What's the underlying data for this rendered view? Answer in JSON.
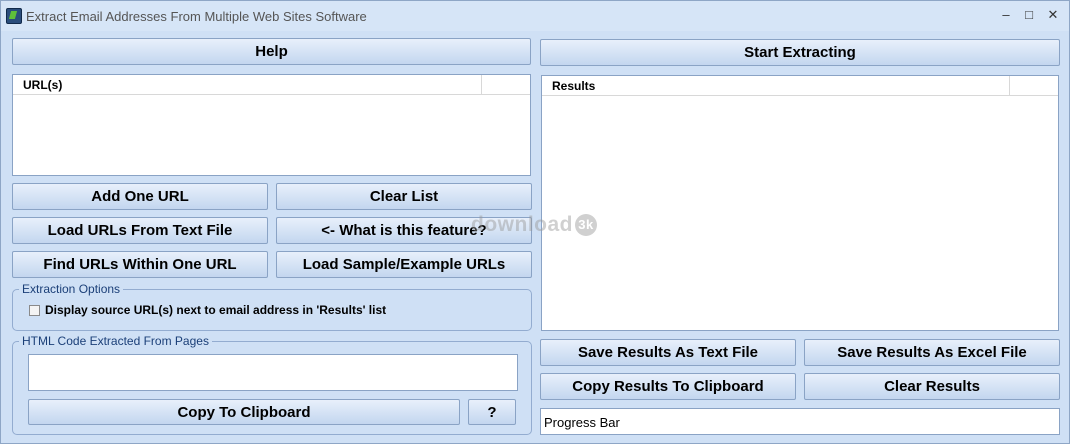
{
  "window": {
    "title": "Extract Email Addresses From Multiple Web Sites Software",
    "controls": {
      "minimize": "–",
      "maximize": "□",
      "close": "✕"
    },
    "icon": "app-icon"
  },
  "left": {
    "help_label": "Help",
    "urls_header": "URL(s)",
    "buttons": {
      "add_one_url": "Add One URL",
      "clear_list": "Clear List",
      "load_from_file": "Load URLs From Text File",
      "what_is_feature": "<- What is this feature?",
      "find_within_url": "Find URLs Within One URL",
      "load_sample": "Load Sample/Example URLs"
    },
    "extraction_options": {
      "title": "Extraction Options",
      "display_source_label": "Display source URL(s) next to email address in 'Results' list",
      "display_source_checked": false
    },
    "html_code": {
      "title": "HTML Code Extracted From Pages",
      "value": "",
      "copy_label": "Copy To Clipboard",
      "question_label": "?"
    }
  },
  "right": {
    "start_label": "Start Extracting",
    "results_header": "Results",
    "buttons": {
      "save_text": "Save Results As Text File",
      "save_excel": "Save Results As Excel File",
      "copy_results": "Copy Results To Clipboard",
      "clear_results": "Clear Results"
    },
    "progress_label": "Progress Bar"
  },
  "watermark": {
    "text": "download",
    "badge": "3k"
  }
}
